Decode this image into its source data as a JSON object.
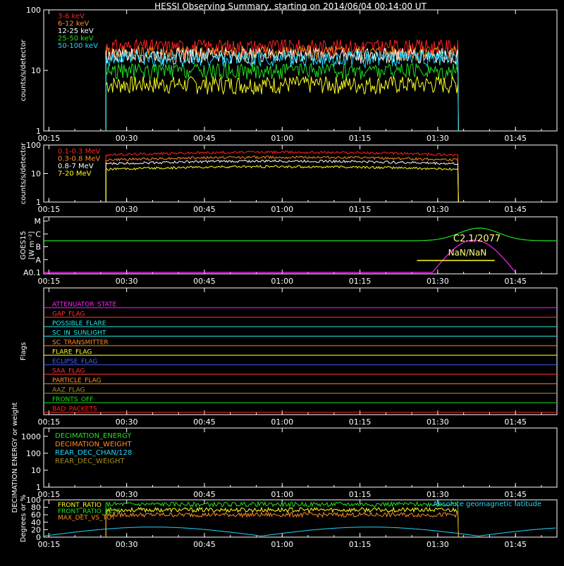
{
  "title": "HESSI Observing Summary, starting on 2014/06/04 00:14:00 UT",
  "time_ticks": [
    "00:15",
    "00:30",
    "00:45",
    "01:00",
    "01:15",
    "01:30",
    "01:45"
  ],
  "chart_data": [
    {
      "type": "line",
      "ylabel": "counts/s/detector",
      "yscale": "log",
      "ylim": [
        1,
        100
      ],
      "yticks": [
        "1",
        "10",
        "100"
      ],
      "xlim": [
        "00:14",
        "01:53"
      ],
      "series": [
        {
          "name": "3-6 keV",
          "color": "#ff2020",
          "level": 25
        },
        {
          "name": "6-12 keV",
          "color": "#ff8c20",
          "level": 20
        },
        {
          "name": "12-25 keV",
          "color": "#ffffff",
          "level": 18
        },
        {
          "name": "25-50 keV",
          "color": "#20e020",
          "level": 10
        },
        {
          "name": "50-100 keV",
          "color": "#20d8ff",
          "level": 16
        }
      ],
      "data_interval": [
        "00:26",
        "01:34"
      ]
    },
    {
      "type": "line",
      "ylabel": "counts/s/detector",
      "yscale": "log",
      "ylim": [
        1,
        100
      ],
      "yticks": [
        "1",
        "10",
        "100"
      ],
      "series": [
        {
          "name": "0.1-0.3 MeV",
          "color": "#ff2020",
          "level": 45
        },
        {
          "name": "0.3-0.8 MeV",
          "color": "#ff8c20",
          "level": 30
        },
        {
          "name": "0.8-7 MeV",
          "color": "#ffffff",
          "level": 22
        },
        {
          "name": "7-20 MeV",
          "color": "#ffff20",
          "level": 14
        }
      ],
      "data_interval": [
        "00:26",
        "01:34"
      ]
    },
    {
      "type": "line",
      "ylabel": "GOES15",
      "ylabel_units": "[W m⁻²]",
      "yticks": [
        "A0.1",
        "A",
        "B",
        "C",
        "M"
      ],
      "annotations": [
        "C2.1/2077",
        "NaN/NaN"
      ]
    },
    {
      "type": "line",
      "ylabel": "Flags",
      "flags": [
        {
          "name": "ATTENUATOR_STATE",
          "color": "#ff20ff"
        },
        {
          "name": "GAP_FLAG",
          "color": "#ff3030"
        },
        {
          "name": "POSSIBLE_FLARE",
          "color": "#20e8e8"
        },
        {
          "name": "SC_IN_SUNLIGHT",
          "color": "#20e8e8"
        },
        {
          "name": "SC_TRANSMITTER",
          "color": "#ff8c20"
        },
        {
          "name": "FLARE_FLAG",
          "color": "#ffff20"
        },
        {
          "name": "ECLIPSE_FLAG",
          "color": "#4060ff"
        },
        {
          "name": "SAA_FLAG",
          "color": "#ff3030"
        },
        {
          "name": "PARTICLE_FLAG",
          "color": "#ff8c20"
        },
        {
          "name": "AAZ_FLAG",
          "color": "#a09020"
        },
        {
          "name": "FRONTS_OFF",
          "color": "#20e020"
        },
        {
          "name": "BAD_PACKETS",
          "color": "#ff2020"
        }
      ]
    },
    {
      "type": "line",
      "ylabel": "DECIMATION ENERGY or weight",
      "yscale": "log",
      "yticks": [
        "1",
        "10",
        "100",
        "1000"
      ],
      "series": [
        {
          "name": "DECIMATION_ENERGY",
          "color": "#20e020"
        },
        {
          "name": "DECIMATION_WEIGHT",
          "color": "#ff8c20"
        },
        {
          "name": "REAR_DEC_CHAN/128",
          "color": "#20d8ff"
        },
        {
          "name": "REAR_DEC_WEIGHT",
          "color": "#a09020"
        }
      ]
    },
    {
      "type": "line",
      "ylabel": "Degrees or %",
      "ylim": [
        0,
        100
      ],
      "yticks": [
        "0",
        "20",
        "40",
        "60",
        "80",
        "100"
      ],
      "series": [
        {
          "name": "FRONT_RATIO",
          "color": "#ffff20",
          "level": 73
        },
        {
          "name": "FRONT_RATIO_1225",
          "color": "#20e020",
          "level": 88
        },
        {
          "name": "MAX_DET_VS_TOT",
          "color": "#ff8c20",
          "level": 60
        }
      ],
      "right_label": "Absolute geomagnetic latitude",
      "right_label_color": "#20d8ff"
    }
  ],
  "colors": {
    "background": "#000000",
    "axis": "#ffffff"
  }
}
